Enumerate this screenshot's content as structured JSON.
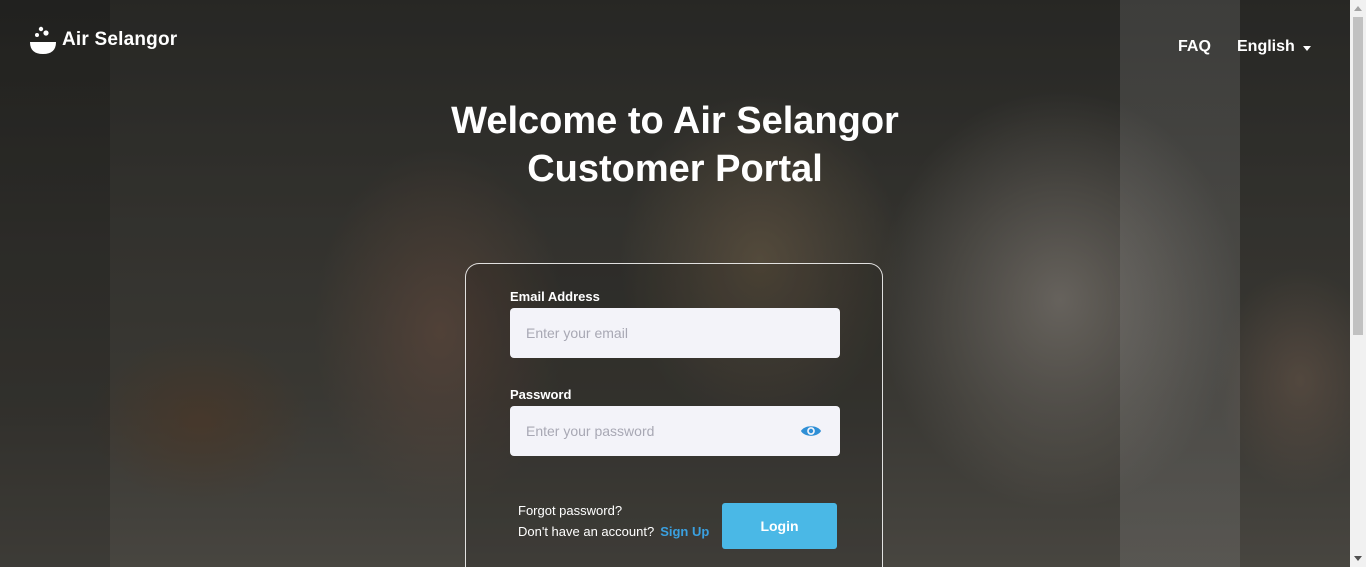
{
  "header": {
    "logo_text": "Air Selangor",
    "faq_label": "FAQ",
    "language_label": "English"
  },
  "hero": {
    "title_line1": "Welcome to Air Selangor",
    "title_line2": "Customer Portal"
  },
  "login_form": {
    "email_label": "Email Address",
    "email_placeholder": "Enter your email",
    "email_value": "",
    "password_label": "Password",
    "password_placeholder": "Enter your password",
    "password_value": "",
    "forgot_password": "Forgot password?",
    "no_account": "Don't have an account?",
    "sign_up": "Sign Up",
    "login_button": "Login"
  },
  "colors": {
    "accent": "#4ab8e6",
    "link": "#3aa0e0",
    "eye_icon": "#2f8fd6"
  }
}
